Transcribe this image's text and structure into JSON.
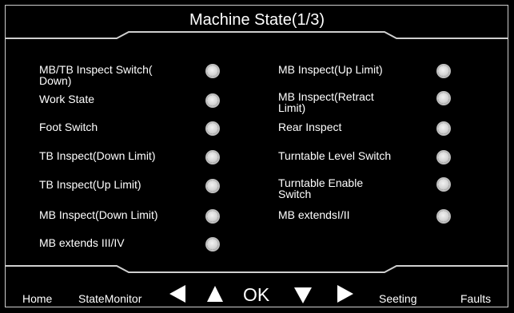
{
  "header": {
    "title": "Machine State(1/3)"
  },
  "left_column": [
    {
      "label": "MB/TB Inspect Switch(\nDown)",
      "state": "off"
    },
    {
      "label": "Work State",
      "state": "off"
    },
    {
      "label": "Foot Switch",
      "state": "off"
    },
    {
      "label": "TB Inspect(Down Limit)",
      "state": "off"
    },
    {
      "label": "TB Inspect(Up Limit)",
      "state": "off"
    },
    {
      "label": "MB Inspect(Down Limit)",
      "state": "off"
    },
    {
      "label": "MB extends III/IV",
      "state": "off"
    }
  ],
  "right_column": [
    {
      "label": "MB Inspect(Up Limit)",
      "state": "off"
    },
    {
      "label": "MB Inspect(Retract\nLimit)",
      "state": "off"
    },
    {
      "label": "Rear Inspect",
      "state": "off"
    },
    {
      "label": "Turntable Level Switch",
      "state": "off"
    },
    {
      "label": "Turntable Enable\nSwitch",
      "state": "off"
    },
    {
      "label": "MB extendsI/II",
      "state": "off"
    }
  ],
  "footer": {
    "home": "Home",
    "state_monitor": "StateMonitor",
    "ok": "OK",
    "seeting": "Seeting",
    "faults": "Faults",
    "left_arrow_icon": "triangle-left-icon",
    "up_arrow_icon": "triangle-up-icon",
    "down_arrow_icon": "triangle-down-icon",
    "right_arrow_icon": "triangle-right-icon"
  },
  "colors": {
    "background": "#000000",
    "text": "#ffffff",
    "led_off": "#d4d4d4",
    "frame": "#cfcfcf"
  }
}
